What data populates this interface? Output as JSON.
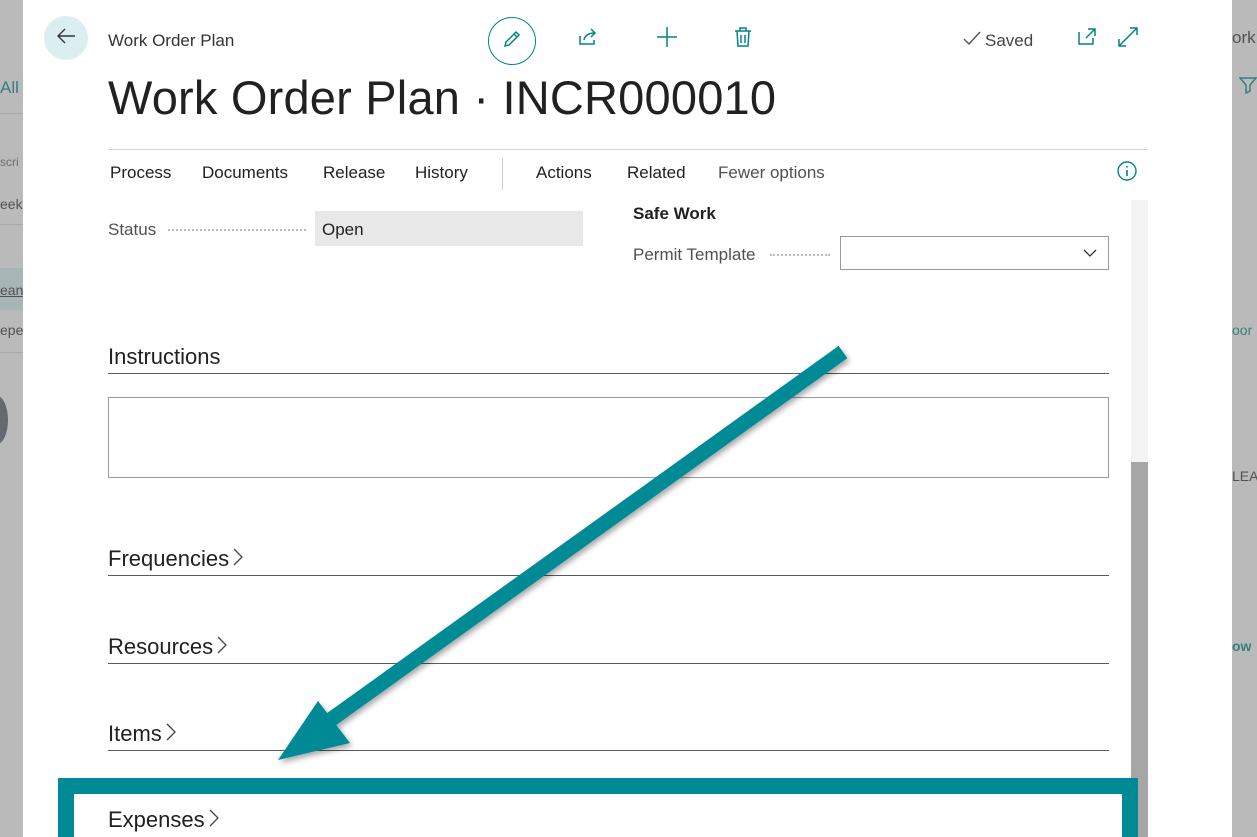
{
  "background": {
    "left_fragments": [
      "All",
      "scri",
      "eek",
      "ean",
      "epe"
    ],
    "right_fragments": [
      "ork",
      "oor",
      "LEA",
      "ow"
    ]
  },
  "header": {
    "breadcrumb": "Work Order Plan",
    "title": "Work Order Plan · INCR000010",
    "saved_label": "Saved"
  },
  "menu": {
    "items": [
      "Process",
      "Documents",
      "Release",
      "History",
      "Actions",
      "Related",
      "Fewer options"
    ]
  },
  "general": {
    "status_label": "Status",
    "status_value": "Open",
    "safe_work_caption": "Safe Work",
    "permit_template_label": "Permit Template",
    "permit_template_value": ""
  },
  "sections": {
    "instructions": "Instructions",
    "frequencies": "Frequencies",
    "resources": "Resources",
    "items": "Items",
    "expenses": "Expenses"
  },
  "colors": {
    "accent": "#008489",
    "highlight": "#008a96"
  },
  "icons": [
    "back-arrow-icon",
    "pencil-icon",
    "share-icon",
    "plus-icon",
    "trash-icon",
    "checkmark-icon",
    "open-in-new-window-icon",
    "expand-icon",
    "info-icon",
    "chevron-down-icon",
    "chevron-right-icon",
    "filter-icon"
  ]
}
